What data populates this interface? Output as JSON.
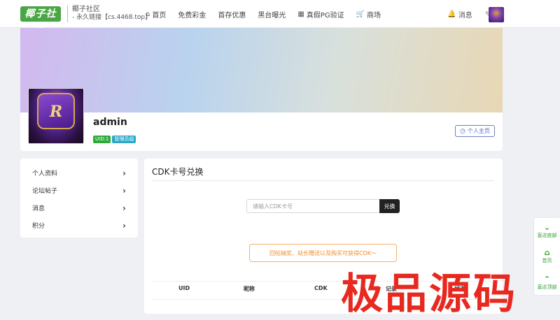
{
  "header": {
    "logo_text": "椰子社区",
    "site_name": "椰子社区",
    "site_link": "- 永久链接【cs.4468.top】",
    "nav": [
      {
        "icon": "home-icon",
        "label": "首页"
      },
      {
        "icon": "",
        "label": "免费彩金"
      },
      {
        "icon": "",
        "label": "首存优惠"
      },
      {
        "icon": "",
        "label": "黑台曝光"
      },
      {
        "icon": "film-icon",
        "label": "真假PG验证"
      },
      {
        "icon": "cart-icon",
        "label": "商场"
      }
    ],
    "messages_label": "消息"
  },
  "profile": {
    "username": "admin",
    "uid_badge": "UID:1",
    "role_badge": "管理员组",
    "home_button": "个人主页"
  },
  "side_menu": [
    {
      "label": "个人资料"
    },
    {
      "label": "论坛帖子"
    },
    {
      "label": "消息"
    },
    {
      "label": "积分"
    }
  ],
  "cdk": {
    "title": "CDK卡号兑换",
    "input_placeholder": "请输入CDK卡号",
    "button_label": "兑换",
    "notice": "回帖抽奖、站长赠送以及购买可获得CDK～",
    "table_headers": [
      "UID",
      "昵称",
      "CDK",
      "记录",
      "状态"
    ]
  },
  "side_tools": [
    {
      "icon": "chevron-down-icon",
      "label": "直达底部"
    },
    {
      "icon": "home-icon",
      "label": "首页"
    },
    {
      "icon": "chevron-up-icon",
      "label": "直达顶部"
    }
  ],
  "watermark": "极品源码"
}
